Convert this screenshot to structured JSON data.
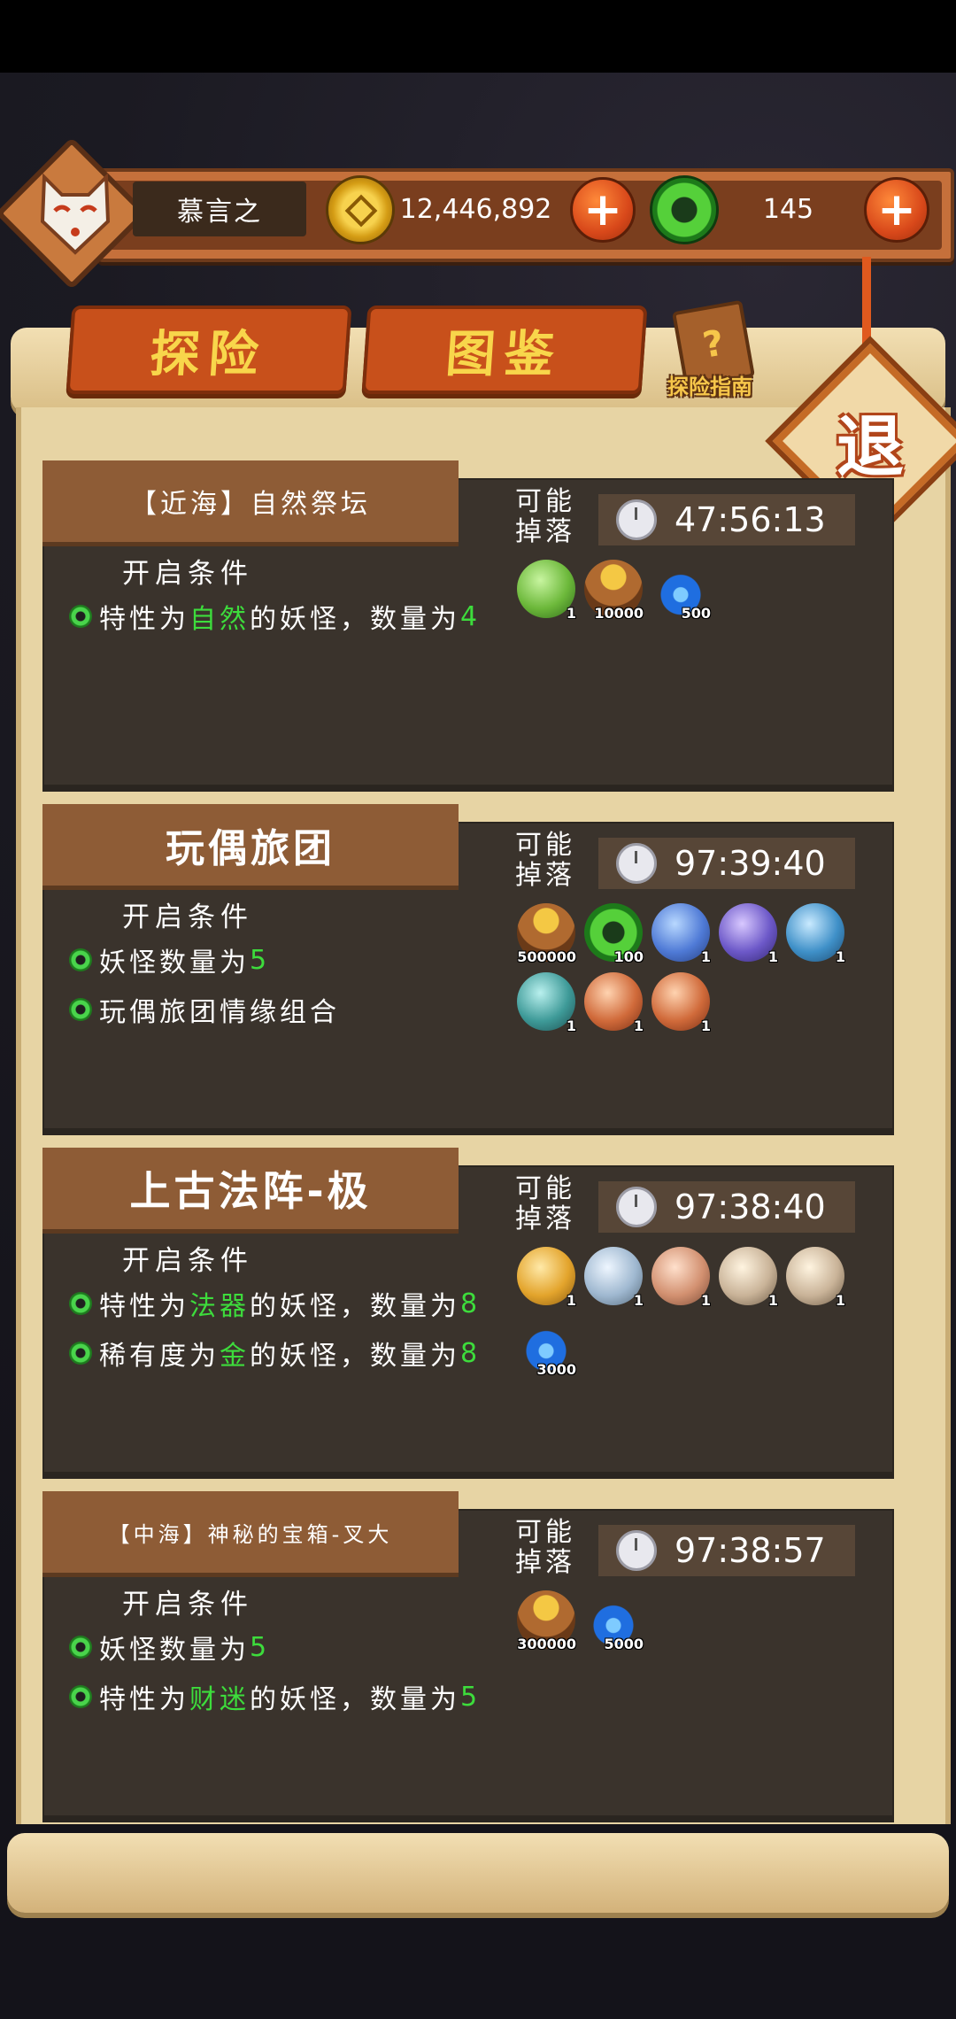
{
  "player": {
    "name": "慕言之"
  },
  "currency": {
    "coins": "12,446,892",
    "jade": "145",
    "add_label": "+"
  },
  "tabs": [
    {
      "label": "探险"
    },
    {
      "label": "图鉴"
    }
  ],
  "guide": {
    "label": "探险指南",
    "glyph": "?"
  },
  "exit": {
    "label": "退"
  },
  "common": {
    "drop_label": "可能掉落",
    "cond_title": "开启条件"
  },
  "cards": [
    {
      "title": "【近海】自然祭坛",
      "timer": "47:56:13",
      "conditions": [
        {
          "pre": "特性为",
          "hl": "自然",
          "mid": "的妖怪，数量为",
          "num": "4"
        }
      ],
      "items": [
        {
          "kind": "green-orb",
          "count": "1"
        },
        {
          "kind": "bag",
          "count": "10000"
        },
        {
          "kind": "fire",
          "count": "500"
        }
      ]
    },
    {
      "title": "玩偶旅团",
      "timer": "97:39:40",
      "conditions": [
        {
          "pre": "妖怪数量为",
          "hl": "",
          "mid": "",
          "num": "5"
        },
        {
          "pre": "玩偶旅团情缘组合",
          "hl": "",
          "mid": "",
          "num": ""
        }
      ],
      "items": [
        {
          "kind": "bag",
          "count": "500000"
        },
        {
          "kind": "jade",
          "count": "100"
        },
        {
          "kind": "blue-orb",
          "count": "1"
        },
        {
          "kind": "purple-orb",
          "count": "1"
        },
        {
          "kind": "sky-orb",
          "count": "1"
        },
        {
          "kind": "teal-orb",
          "count": "1"
        },
        {
          "kind": "red-orb",
          "count": "1"
        },
        {
          "kind": "red-orb",
          "count": "1"
        }
      ]
    },
    {
      "title": "上古法阵-极",
      "timer": "97:38:40",
      "conditions": [
        {
          "pre": "特性为",
          "hl": "法器",
          "mid": "的妖怪，数量为",
          "num": "8"
        },
        {
          "pre": "稀有度为",
          "hl": "金",
          "mid": "的妖怪，数量为",
          "num": "8"
        }
      ],
      "items": [
        {
          "kind": "gold-orb",
          "count": "1"
        },
        {
          "kind": "silver-orb",
          "count": "1"
        },
        {
          "kind": "pink-orb",
          "count": "1"
        },
        {
          "kind": "cream-orb",
          "count": "1"
        },
        {
          "kind": "cream-orb",
          "count": "1"
        },
        {
          "kind": "fire",
          "count": "3000"
        }
      ]
    },
    {
      "title": "【中海】神秘的宝箱-叉大",
      "timer": "97:38:57",
      "conditions": [
        {
          "pre": "妖怪数量为",
          "hl": "",
          "mid": "",
          "num": "5"
        },
        {
          "pre": "特性为",
          "hl": "财迷",
          "mid": "的妖怪，数量为",
          "num": "5"
        }
      ],
      "items": [
        {
          "kind": "bag",
          "count": "300000"
        },
        {
          "kind": "fire",
          "count": "5000"
        }
      ]
    }
  ]
}
